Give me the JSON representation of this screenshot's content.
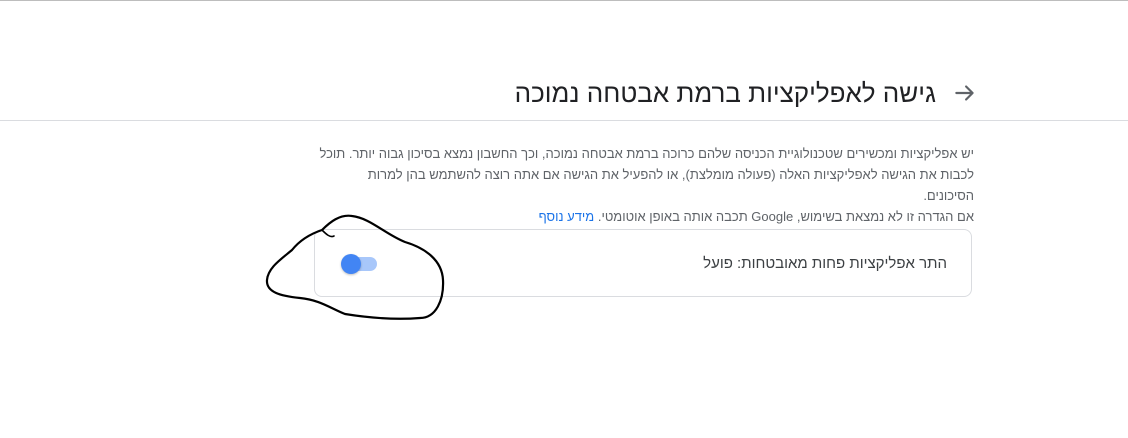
{
  "header": {
    "title": "גישה לאפליקציות ברמת אבטחה נמוכה",
    "back_icon": "arrow-right-icon"
  },
  "description": {
    "line1": "יש אפליקציות ומכשירים שטכנולוגיית הכניסה שלהם כרוכה ברמת אבטחה נמוכה, וכך החשבון נמצא בסיכון גבוה יותר. תוכל",
    "line2": "לכבות את הגישה לאפליקציות האלה (פעולה מומלצת), או להפעיל את הגישה אם אתה רוצה להשתמש בהן למרות הסיכונים.",
    "line3": "אם הגדרה זו לא נמצאת בשימוש, Google תכבה אותה באופן אוטומטי.",
    "learn_more": "מידע נוסף"
  },
  "setting": {
    "label": "התר אפליקציות פחות מאובטחות: פועל",
    "toggle_on": true
  },
  "colors": {
    "accent": "#4285f4",
    "track": "#a8c7fa",
    "link": "#1a73e8",
    "annotation": "#000000"
  }
}
